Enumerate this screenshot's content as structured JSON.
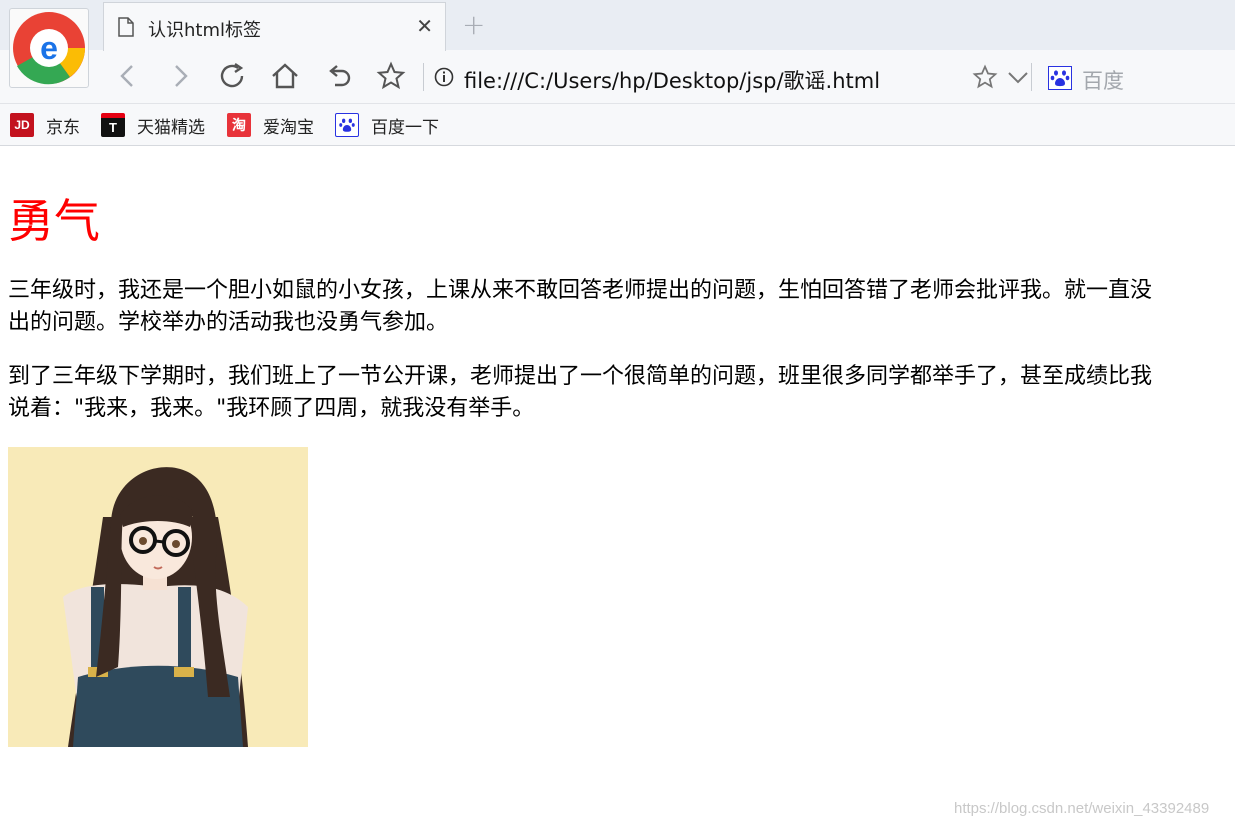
{
  "tab": {
    "title": "认识html标签",
    "close": "✕",
    "new_tab": "+"
  },
  "toolbar": {
    "url": "file:///C:/Users/hp/Desktop/jsp/歌谣.html",
    "search_placeholder": "百度"
  },
  "bookmarks": [
    {
      "icon_text": "JD",
      "label": "京东",
      "color": "#c3121e"
    },
    {
      "icon_text": "T",
      "label": "天猫精选",
      "color": "#111111"
    },
    {
      "icon_text": "淘",
      "label": "爱淘宝",
      "color": "#e8333a"
    },
    {
      "icon_text": "",
      "label": "百度一下",
      "color": "#2932e1"
    }
  ],
  "page": {
    "heading": "勇气",
    "heading_color": "#ff0000",
    "paragraphs": [
      {
        "line1": "三年级时，我还是一个胆小如鼠的小女孩，上课从来不敢回答老师提出的问题，生怕回答错了老师会批评我。就一直没",
        "line2": "出的问题。学校举办的活动我也没勇气参加。"
      },
      {
        "line1": "到了三年级下学期时，我们班上了一节公开课，老师提出了一个很简单的问题，班里很多同学都举手了，甚至成绩比我",
        "line2": "说着：\"我来，我来。\"我环顾了四周，就我没有举手。"
      }
    ]
  },
  "watermark": "https://blog.csdn.net/weixin_43392489"
}
